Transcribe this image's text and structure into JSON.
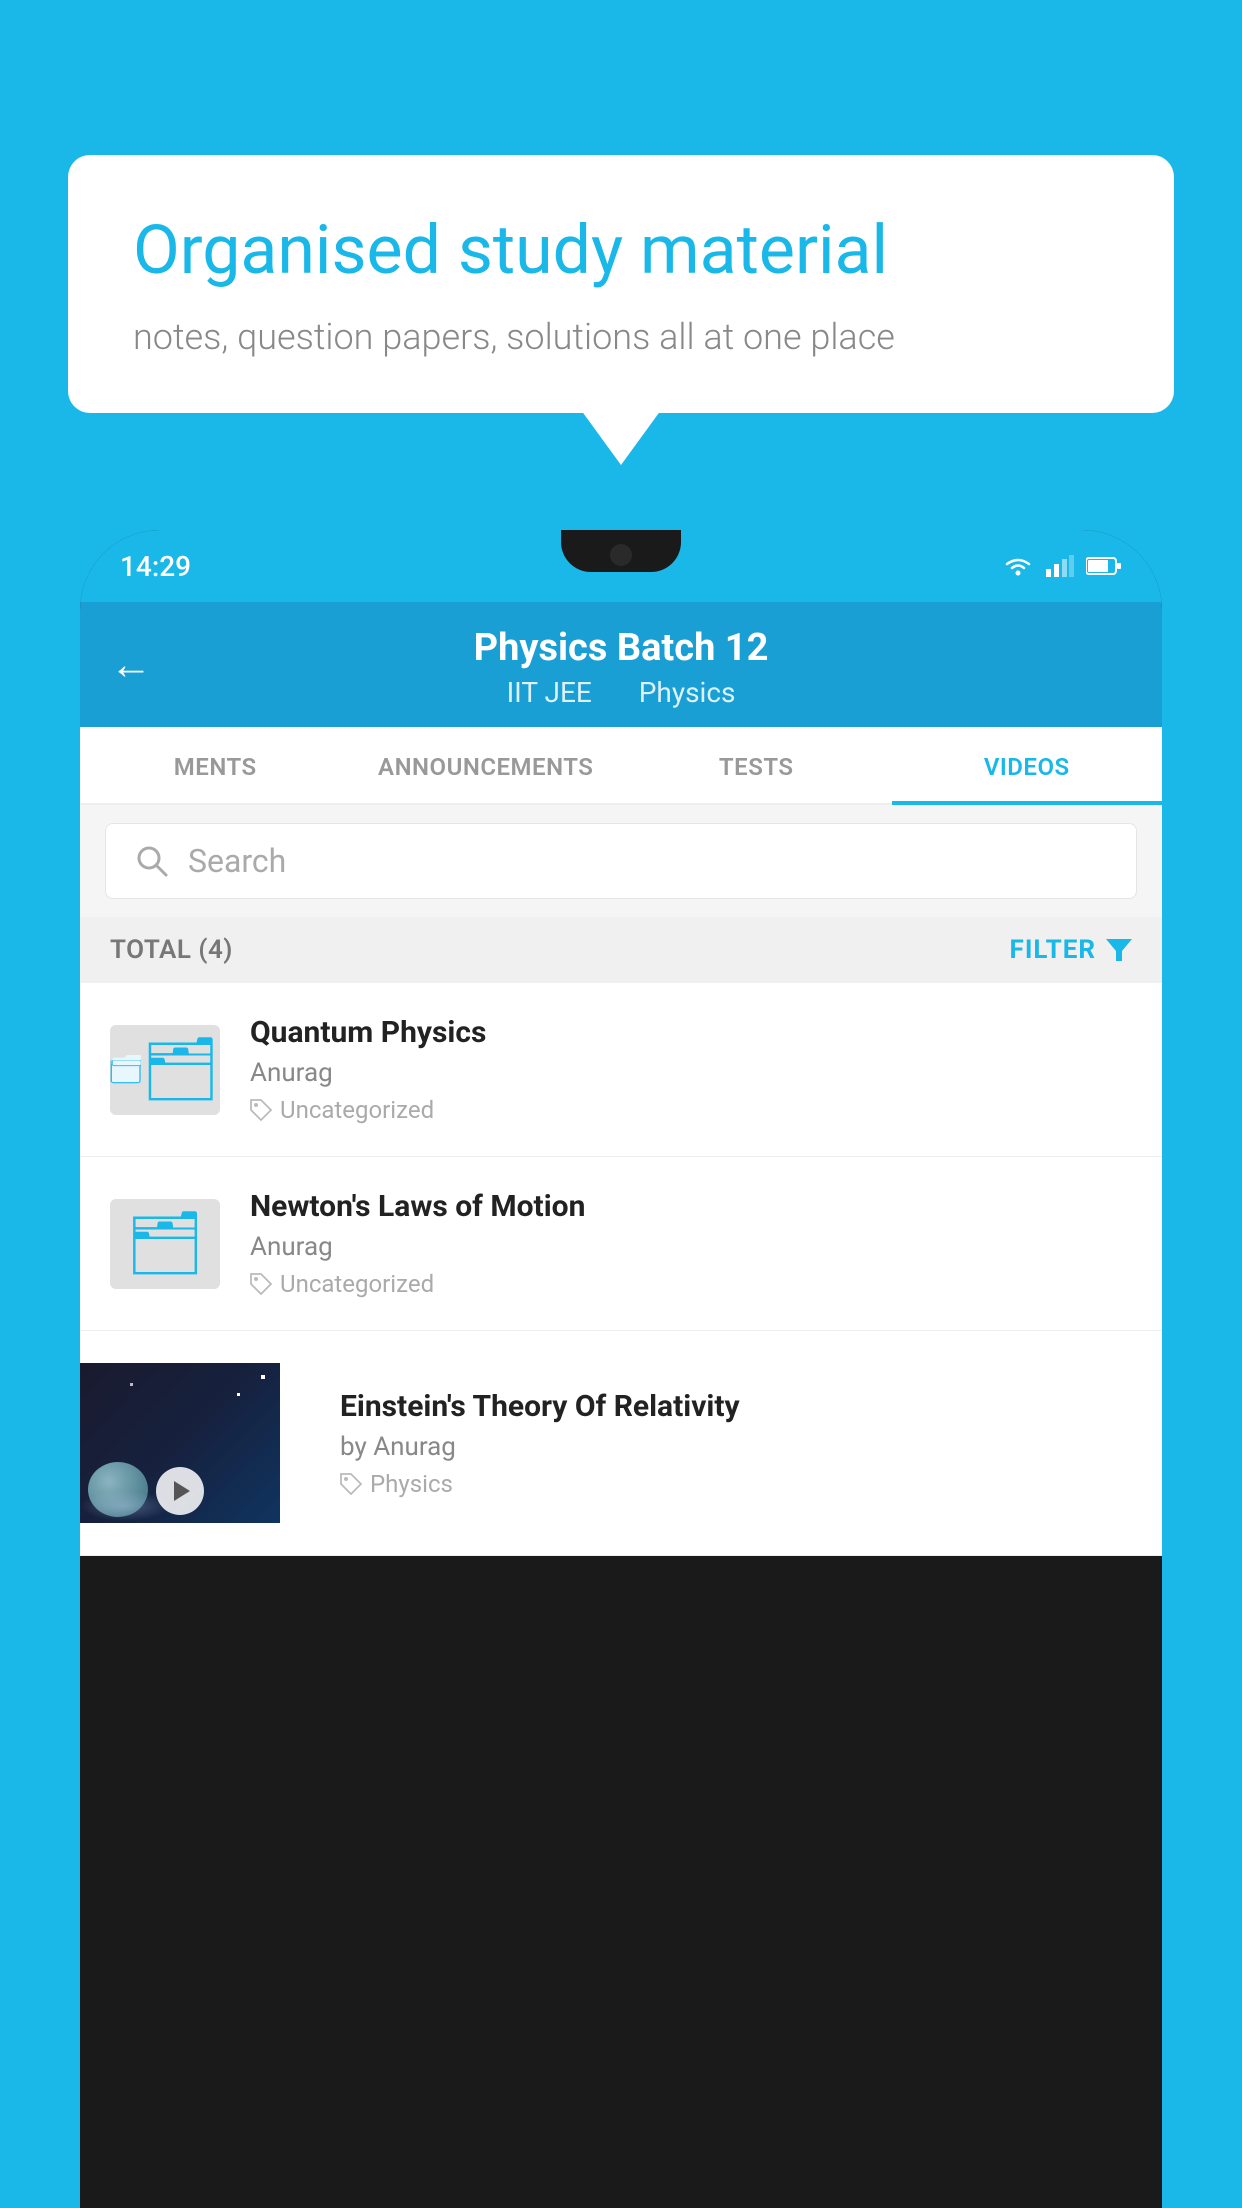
{
  "background": {
    "color": "#1ab8e8"
  },
  "speech_bubble": {
    "title": "Organised study material",
    "subtitle": "notes, question papers, solutions all at one place"
  },
  "phone": {
    "status_bar": {
      "time": "14:29",
      "wifi": "wifi",
      "signal": "signal",
      "battery": "battery"
    },
    "header": {
      "back_label": "←",
      "title": "Physics Batch 12",
      "subtitle1": "IIT JEE",
      "subtitle2": "Physics"
    },
    "tabs": [
      {
        "label": "MENTS",
        "active": false
      },
      {
        "label": "ANNOUNCEMENTS",
        "active": false
      },
      {
        "label": "TESTS",
        "active": false
      },
      {
        "label": "VIDEOS",
        "active": true
      }
    ],
    "search": {
      "placeholder": "Search"
    },
    "filter_bar": {
      "total_label": "TOTAL (4)",
      "filter_label": "FILTER"
    },
    "videos": [
      {
        "title": "Quantum Physics",
        "author": "Anurag",
        "tag": "Uncategorized",
        "has_thumb": false
      },
      {
        "title": "Newton's Laws of Motion",
        "author": "Anurag",
        "tag": "Uncategorized",
        "has_thumb": false
      },
      {
        "title": "Einstein's Theory Of Relativity",
        "author": "by Anurag",
        "tag": "Physics",
        "has_thumb": true
      }
    ]
  }
}
